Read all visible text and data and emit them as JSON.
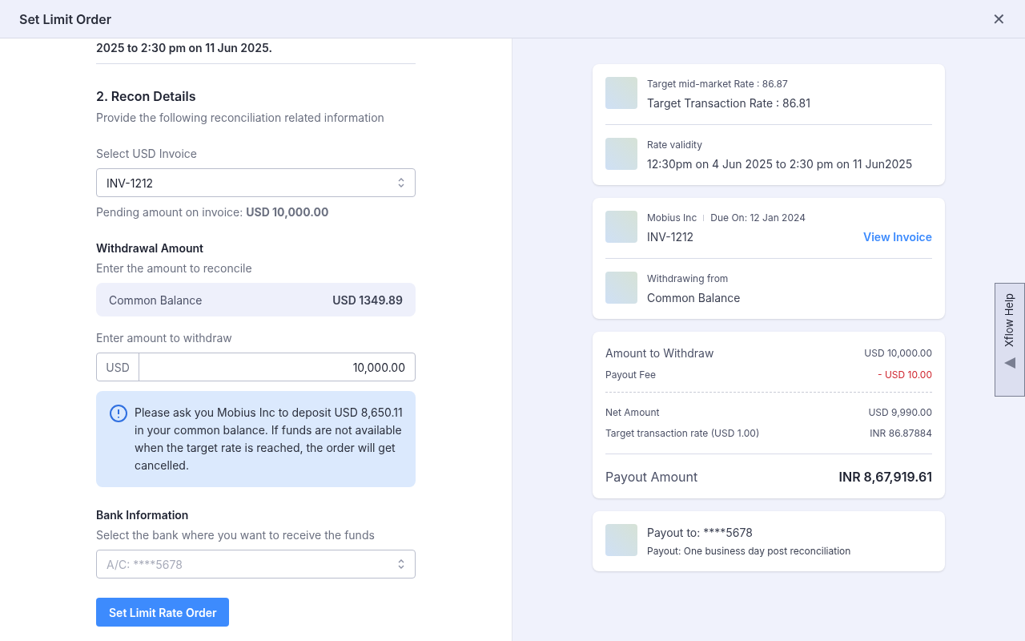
{
  "window": {
    "title": "Set Limit Order",
    "close": "✕"
  },
  "form": {
    "cut_text": "2025 to 2:30 pm on 11 Jun 2025.",
    "section_title": "2. Recon Details",
    "section_subtitle": "Provide the following reconciliation related information",
    "invoice_label": "Select USD Invoice",
    "invoice_value": "INV-1212",
    "pending_label": "Pending amount on invoice: ",
    "pending_amount": "USD 10,000.00",
    "withdrawal_title": "Withdrawal Amount",
    "withdrawal_subtitle": "Enter the amount to reconcile",
    "balance_label": "Common Balance",
    "balance_value": "USD 1349.89",
    "amount_label": "Enter amount to withdraw",
    "currency": "USD",
    "amount_value": "10,000.00",
    "notice": "Please ask you Mobius Inc to deposit USD 8,650.11 in your common balance. If funds are not available when the target rate is reached, the order will get cancelled.",
    "bank_title": "Bank Information",
    "bank_subtitle": "Select the bank where you want to receive the funds",
    "bank_placeholder": "A/C: ****5678",
    "submit": "Set Limit Rate Order"
  },
  "summary": {
    "rate_card": [
      {
        "small": "Target mid-market Rate : 86.87",
        "main": "Target Transaction Rate : 86.81"
      },
      {
        "small": "Rate validity",
        "main": "12:30pm on 4 Jun 2025 to 2:30 pm on 11 Jun2025"
      }
    ],
    "invoice_card": {
      "company": "Mobius Inc",
      "due": "Due On: 12 Jan 2024",
      "invoice": "INV-1212",
      "link": "View Invoice",
      "from_label": "Withdrawing from",
      "from_value": "Common Balance"
    },
    "amounts": [
      {
        "label": "Amount to Withdraw",
        "value": "USD 10,000.00",
        "kind": "primary"
      },
      {
        "label": "Payout Fee",
        "value": "- USD 10.00",
        "kind": "fee"
      },
      {
        "label": "Net Amount",
        "value": "USD 9,990.00",
        "kind": "secondary"
      },
      {
        "label": "Target transaction rate (USD  1.00)",
        "value": "INR 86.87884",
        "kind": "secondary"
      }
    ],
    "payout_label": "Payout Amount",
    "payout_value": "INR 8,67,919.61",
    "payout_to": "Payout to: ****5678",
    "payout_note": "Payout: One business day post reconciliation"
  },
  "help_tab": "Xflow Help"
}
